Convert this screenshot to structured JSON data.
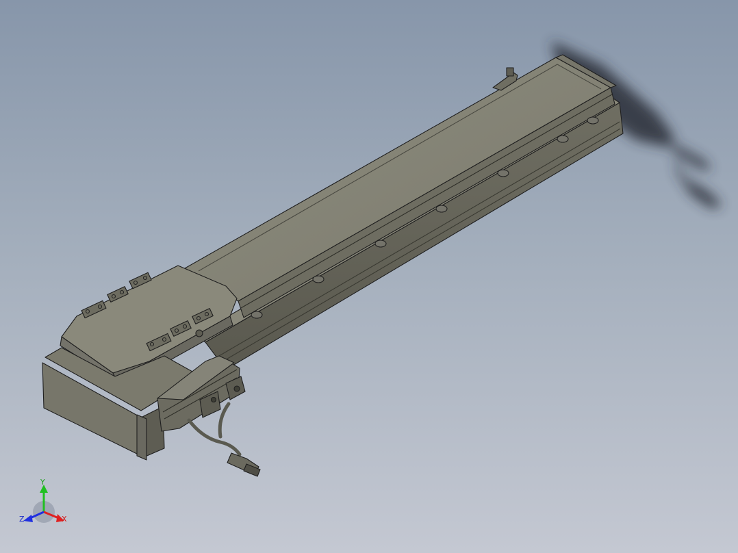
{
  "viewport": {
    "background_top": "#8796aa",
    "background_bottom": "#c4c8d2"
  },
  "model": {
    "body_color": "#7d7c6e",
    "top_face_color": "#8c8b7c",
    "edge_color": "#1f1f1f",
    "shadow_color": "#2a2f38"
  },
  "triad": {
    "x_label": "X",
    "y_label": "Y",
    "z_label": "Z",
    "x_color": "#e02020",
    "y_color": "#20c020",
    "z_color": "#2030e0"
  }
}
